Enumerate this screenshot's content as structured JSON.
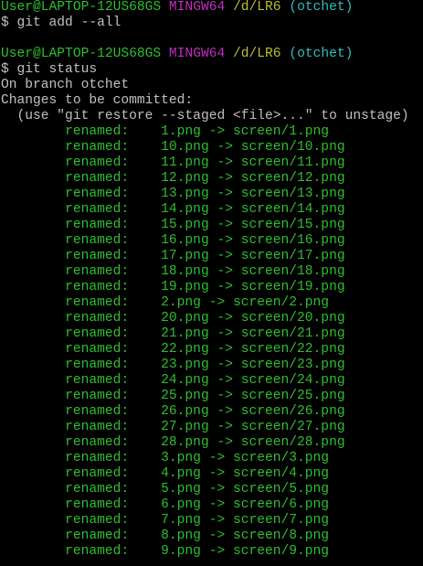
{
  "terminal": {
    "colors": {
      "background": "#000000",
      "text": "#c0c0c0",
      "user": "#2fbf2f",
      "system": "#bf2fbf",
      "path": "#bfbf2f",
      "branch": "#2fbfbf",
      "staged": "#2fbf2f"
    },
    "prompt1": {
      "user_host": "User@LAPTOP-12US68GS",
      "system": "MINGW64",
      "path": "/d/LR6",
      "branch": "(otchet)"
    },
    "command1": "$ git add --all",
    "prompt2": {
      "user_host": "User@LAPTOP-12US68GS",
      "system": "MINGW64",
      "path": "/d/LR6",
      "branch": "(otchet)"
    },
    "command2": "$ git status",
    "status_branch": "On branch otchet",
    "status_header": "Changes to be committed:",
    "status_hint": "  (use \"git restore --staged <file>...\" to unstage)",
    "renames": [
      {
        "label": "renamed:",
        "change": "1.png -> screen/1.png"
      },
      {
        "label": "renamed:",
        "change": "10.png -> screen/10.png"
      },
      {
        "label": "renamed:",
        "change": "11.png -> screen/11.png"
      },
      {
        "label": "renamed:",
        "change": "12.png -> screen/12.png"
      },
      {
        "label": "renamed:",
        "change": "13.png -> screen/13.png"
      },
      {
        "label": "renamed:",
        "change": "14.png -> screen/14.png"
      },
      {
        "label": "renamed:",
        "change": "15.png -> screen/15.png"
      },
      {
        "label": "renamed:",
        "change": "16.png -> screen/16.png"
      },
      {
        "label": "renamed:",
        "change": "17.png -> screen/17.png"
      },
      {
        "label": "renamed:",
        "change": "18.png -> screen/18.png"
      },
      {
        "label": "renamed:",
        "change": "19.png -> screen/19.png"
      },
      {
        "label": "renamed:",
        "change": "2.png -> screen/2.png"
      },
      {
        "label": "renamed:",
        "change": "20.png -> screen/20.png"
      },
      {
        "label": "renamed:",
        "change": "21.png -> screen/21.png"
      },
      {
        "label": "renamed:",
        "change": "22.png -> screen/22.png"
      },
      {
        "label": "renamed:",
        "change": "23.png -> screen/23.png"
      },
      {
        "label": "renamed:",
        "change": "24.png -> screen/24.png"
      },
      {
        "label": "renamed:",
        "change": "25.png -> screen/25.png"
      },
      {
        "label": "renamed:",
        "change": "26.png -> screen/26.png"
      },
      {
        "label": "renamed:",
        "change": "27.png -> screen/27.png"
      },
      {
        "label": "renamed:",
        "change": "28.png -> screen/28.png"
      },
      {
        "label": "renamed:",
        "change": "3.png -> screen/3.png"
      },
      {
        "label": "renamed:",
        "change": "4.png -> screen/4.png"
      },
      {
        "label": "renamed:",
        "change": "5.png -> screen/5.png"
      },
      {
        "label": "renamed:",
        "change": "6.png -> screen/6.png"
      },
      {
        "label": "renamed:",
        "change": "7.png -> screen/7.png"
      },
      {
        "label": "renamed:",
        "change": "8.png -> screen/8.png"
      },
      {
        "label": "renamed:",
        "change": "9.png -> screen/9.png"
      }
    ]
  }
}
